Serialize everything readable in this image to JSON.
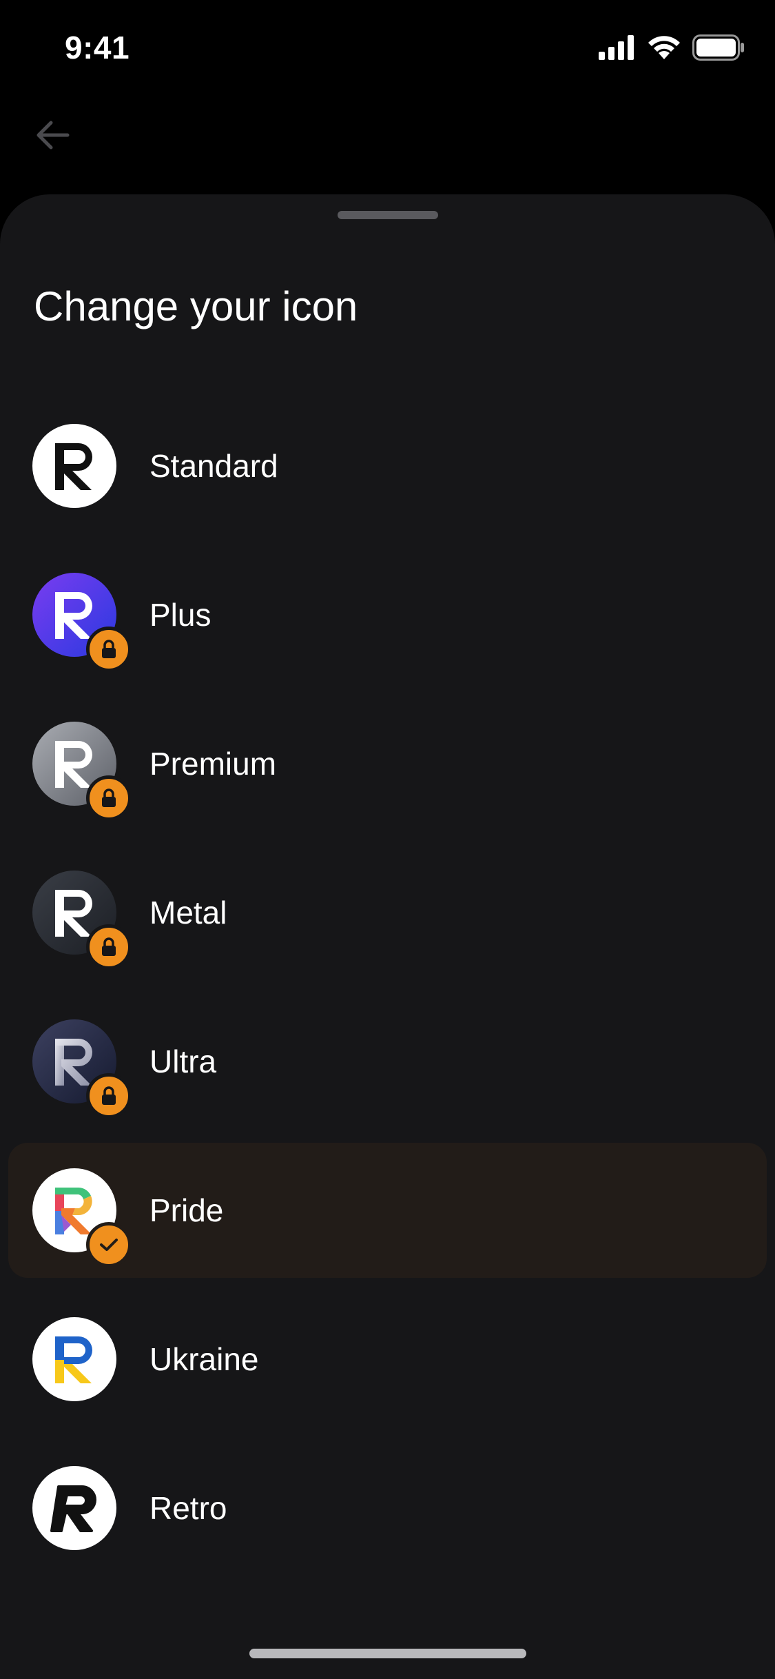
{
  "status_bar": {
    "time": "9:41",
    "icons": [
      "cellular-signal-icon",
      "wifi-icon",
      "battery-icon"
    ]
  },
  "navigation": {
    "back_icon": "arrow-left-icon"
  },
  "sheet": {
    "title": "Change your icon",
    "items": [
      {
        "label": "Standard",
        "icon": "standard-app-icon",
        "state": "available"
      },
      {
        "label": "Plus",
        "icon": "plus-app-icon",
        "state": "locked"
      },
      {
        "label": "Premium",
        "icon": "premium-app-icon",
        "state": "locked"
      },
      {
        "label": "Metal",
        "icon": "metal-app-icon",
        "state": "locked"
      },
      {
        "label": "Ultra",
        "icon": "ultra-app-icon",
        "state": "locked"
      },
      {
        "label": "Pride",
        "icon": "pride-app-icon",
        "state": "selected"
      },
      {
        "label": "Ukraine",
        "icon": "ukraine-app-icon",
        "state": "available"
      },
      {
        "label": "Retro",
        "icon": "retro-app-icon",
        "state": "available"
      }
    ]
  },
  "colors": {
    "background": "#000000",
    "sheet": "#161618",
    "selected_row": "#221c18",
    "badge": "#f0901e",
    "text": "#ffffff"
  }
}
